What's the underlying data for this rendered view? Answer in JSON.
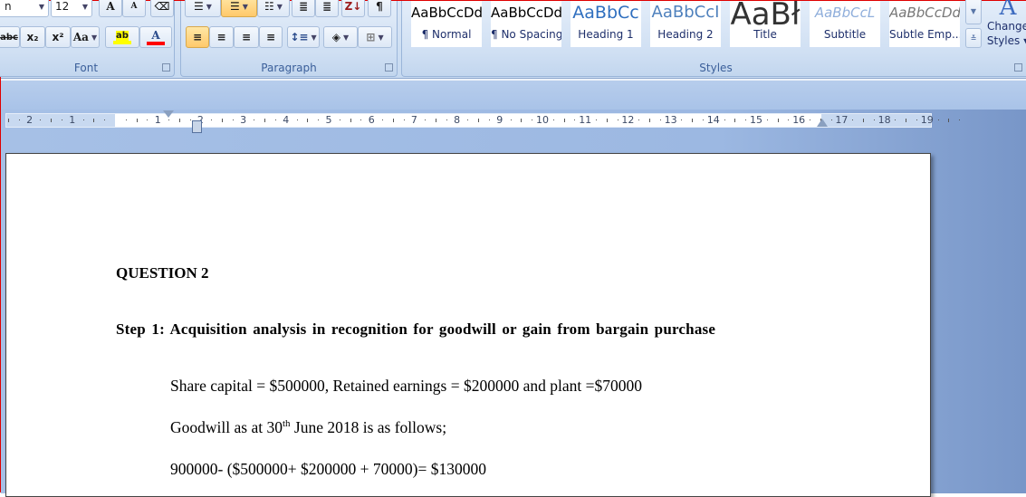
{
  "ribbon": {
    "font": {
      "label": "Font",
      "font_name_value": "n",
      "font_size_value": "12",
      "grow_font": "A",
      "shrink_font": "A",
      "strikethrough": "abc",
      "subscript": "x₂",
      "superscript": "x²",
      "change_case": "Aa",
      "highlight": "ab",
      "font_color": "A",
      "highlight_color": "#ffff00",
      "font_color_value": "#ff0000"
    },
    "paragraph": {
      "label": "Paragraph",
      "sort": "Z↓",
      "show_marks": "¶"
    },
    "styles": {
      "label": "Styles",
      "items": [
        {
          "preview": "AaBbCcDd",
          "name": "¶ Normal"
        },
        {
          "preview": "AaBbCcDd",
          "name": "¶ No Spacing"
        },
        {
          "preview": "AaBbCc",
          "name": "Heading 1"
        },
        {
          "preview": "AaBbCcI",
          "name": "Heading 2"
        },
        {
          "preview": "AaBł",
          "name": "Title"
        },
        {
          "preview": "AaBbCcL",
          "name": "Subtitle"
        },
        {
          "preview": "AaBbCcDd",
          "name": "Subtle Emp..."
        }
      ],
      "change_styles_line1": "Change",
      "change_styles_line2": "Styles ▾"
    }
  },
  "ruler": {
    "labels": [
      "2",
      "1",
      "1",
      "2",
      "3",
      "4",
      "5",
      "6",
      "7",
      "8",
      "9",
      "10",
      "11",
      "12",
      "13",
      "14",
      "15",
      "16",
      "17",
      "18",
      "19"
    ]
  },
  "document": {
    "heading": "QUESTION 2",
    "step": "Step 1: Acquisition  analysis in recognition for goodwill or gain from bargain purchase",
    "line1": "Share capital = $500000, Retained earnings = $200000 and plant =$70000",
    "line2_pre": "Goodwill as at 30",
    "line2_sup": "th",
    "line2_post": " June 2018 is as follows;",
    "line3": "900000- ($500000+ $200000 + 70000)= $130000"
  }
}
